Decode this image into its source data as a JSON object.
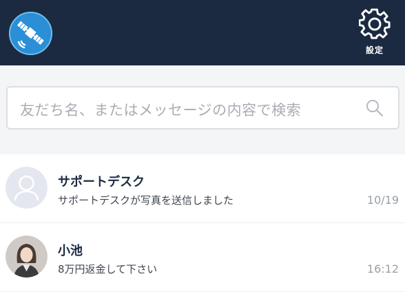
{
  "header": {
    "logo_icon": "satellite-icon",
    "settings_icon": "gear-icon",
    "settings_label": "設定",
    "background": "#1b2a40"
  },
  "search": {
    "placeholder": "友だち名、またはメッセージの内容で検索",
    "icon": "search-icon"
  },
  "chats": [
    {
      "name": "サポートデスク",
      "preview": "サポートデスクが写真を送信しました",
      "time": "10/19",
      "avatar": "default-person-icon"
    },
    {
      "name": "小池",
      "preview": "8万円返金して下さい",
      "time": "16:12",
      "avatar": "photo-avatar"
    }
  ]
}
